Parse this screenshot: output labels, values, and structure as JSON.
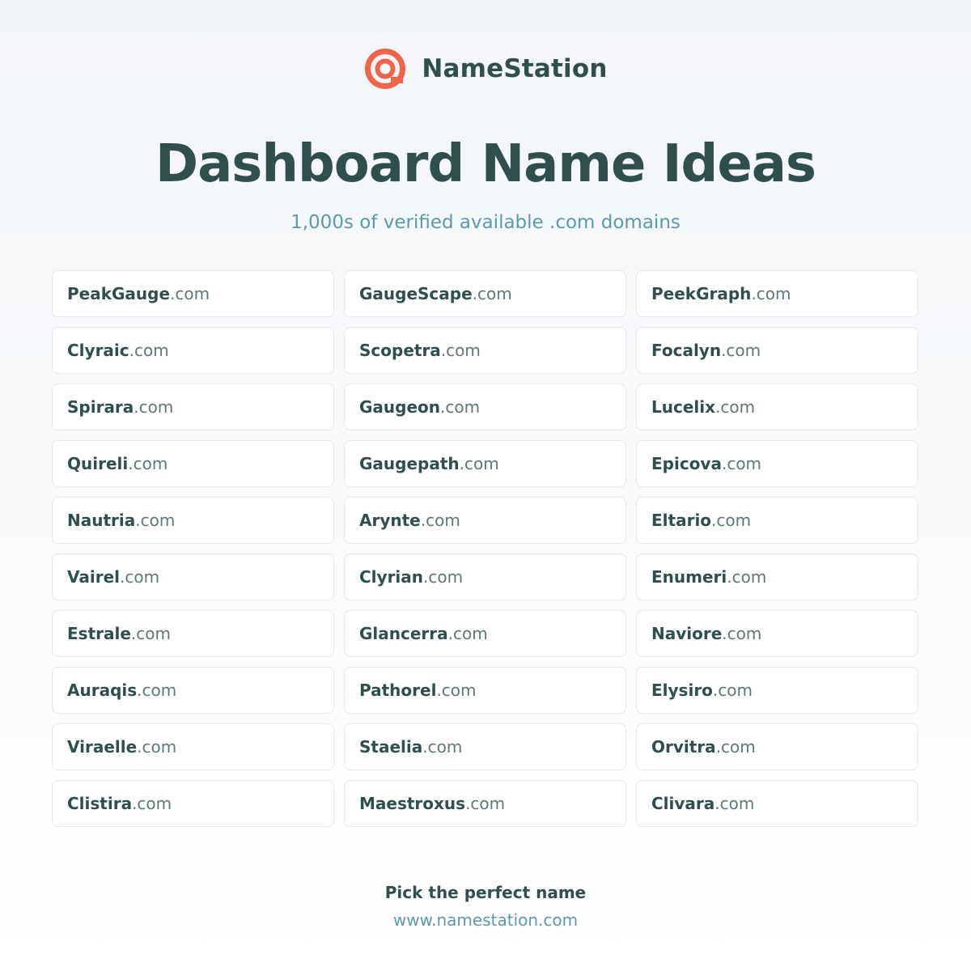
{
  "brand": {
    "name": "NameStation",
    "logo_icon": "at-target-icon",
    "logo_color": "#f26449"
  },
  "header": {
    "title": "Dashboard Name Ideas",
    "subtitle": "1,000s of verified available .com domains"
  },
  "colors": {
    "text_dark": "#2f4f4f",
    "accent_teal": "#5b9aaa",
    "card_border": "#e3e8ec"
  },
  "domains": [
    {
      "name": "PeakGauge",
      "tld": ".com"
    },
    {
      "name": "GaugeScape",
      "tld": ".com"
    },
    {
      "name": "PeekGraph",
      "tld": ".com"
    },
    {
      "name": "Clyraic",
      "tld": ".com"
    },
    {
      "name": "Scopetra",
      "tld": ".com"
    },
    {
      "name": "Focalyn",
      "tld": ".com"
    },
    {
      "name": "Spirara",
      "tld": ".com"
    },
    {
      "name": "Gaugeon",
      "tld": ".com"
    },
    {
      "name": "Lucelix",
      "tld": ".com"
    },
    {
      "name": "Quireli",
      "tld": ".com"
    },
    {
      "name": "Gaugepath",
      "tld": ".com"
    },
    {
      "name": "Epicova",
      "tld": ".com"
    },
    {
      "name": "Nautria",
      "tld": ".com"
    },
    {
      "name": "Arynte",
      "tld": ".com"
    },
    {
      "name": "Eltario",
      "tld": ".com"
    },
    {
      "name": "Vairel",
      "tld": ".com"
    },
    {
      "name": "Clyrian",
      "tld": ".com"
    },
    {
      "name": "Enumeri",
      "tld": ".com"
    },
    {
      "name": "Estrale",
      "tld": ".com"
    },
    {
      "name": "Glancerra",
      "tld": ".com"
    },
    {
      "name": "Naviore",
      "tld": ".com"
    },
    {
      "name": "Auraqis",
      "tld": ".com"
    },
    {
      "name": "Pathorel",
      "tld": ".com"
    },
    {
      "name": "Elysiro",
      "tld": ".com"
    },
    {
      "name": "Viraelle",
      "tld": ".com"
    },
    {
      "name": "Staelia",
      "tld": ".com"
    },
    {
      "name": "Orvitra",
      "tld": ".com"
    },
    {
      "name": "Clistira",
      "tld": ".com"
    },
    {
      "name": "Maestroxus",
      "tld": ".com"
    },
    {
      "name": "Clivara",
      "tld": ".com"
    }
  ],
  "footer": {
    "cta": "Pick the perfect name",
    "url": "www.namestation.com"
  }
}
